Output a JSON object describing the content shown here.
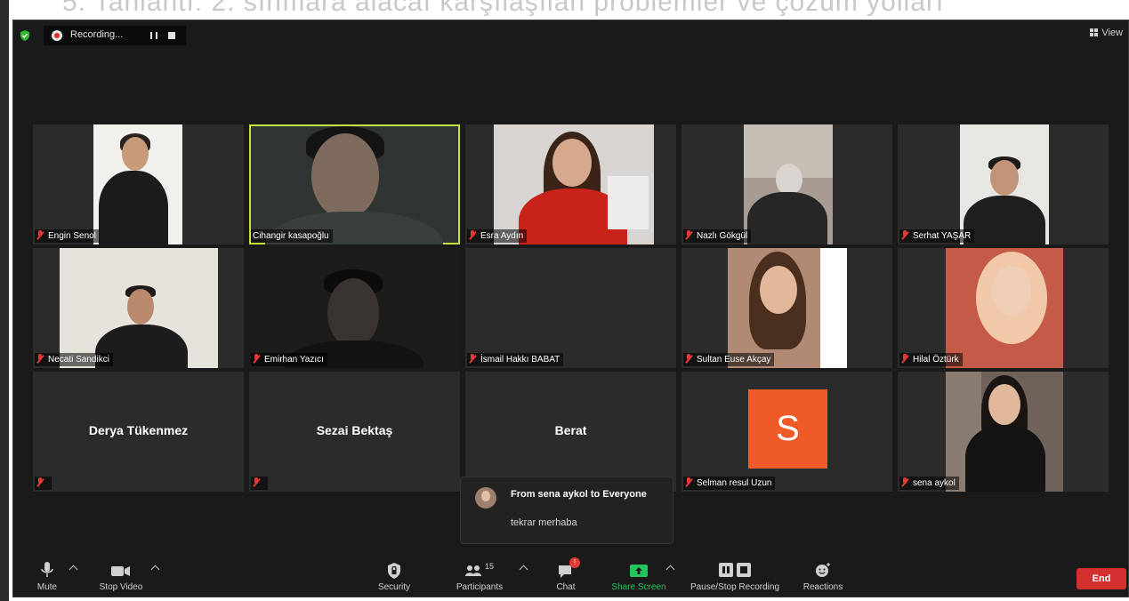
{
  "background_text": "5. Tanlantı: 2. sınıflara alacaı karşılaşılan problemler ve çözüm yolları",
  "topbar": {
    "recording_label": "Recording...",
    "view_label": "View"
  },
  "participants": [
    {
      "name": "Engin Senol"
    },
    {
      "name": "Cihangir kasapoğlu"
    },
    {
      "name": "Esra Aydın"
    },
    {
      "name": "Nazlı Gökgül"
    },
    {
      "name": "Serhat YAŞAR"
    },
    {
      "name": "Necati Sandikci"
    },
    {
      "name": "Emirhan Yazıcı"
    },
    {
      "name": "İsmail Hakkı BABAT"
    },
    {
      "name": "Sultan Euse Akçay"
    },
    {
      "name": "Hilal Öztürk"
    },
    {
      "name": "Derya Tükenmez"
    },
    {
      "name": "Sezai Bektaş"
    },
    {
      "name": "Berat"
    },
    {
      "name": "Selman resul Uzun",
      "avatar_letter": "S"
    },
    {
      "name": "sena aykol"
    }
  ],
  "chat": {
    "from": "From sena aykol to Everyone",
    "message": "tekrar merhaba"
  },
  "toolbar": {
    "mute": "Mute",
    "stop_video": "Stop Video",
    "security": "Security",
    "participants": "Participants",
    "participants_count": "15",
    "chat": "Chat",
    "chat_badge": "!",
    "share_screen": "Share Screen",
    "pause_recording": "Pause/Stop Recording",
    "reactions": "Reactions",
    "end": "End"
  },
  "colors": {
    "active_speaker": "#c7e13c",
    "share_green": "#22c55e",
    "end_red": "#d32f2f",
    "avatar_orange": "#f05a28"
  }
}
